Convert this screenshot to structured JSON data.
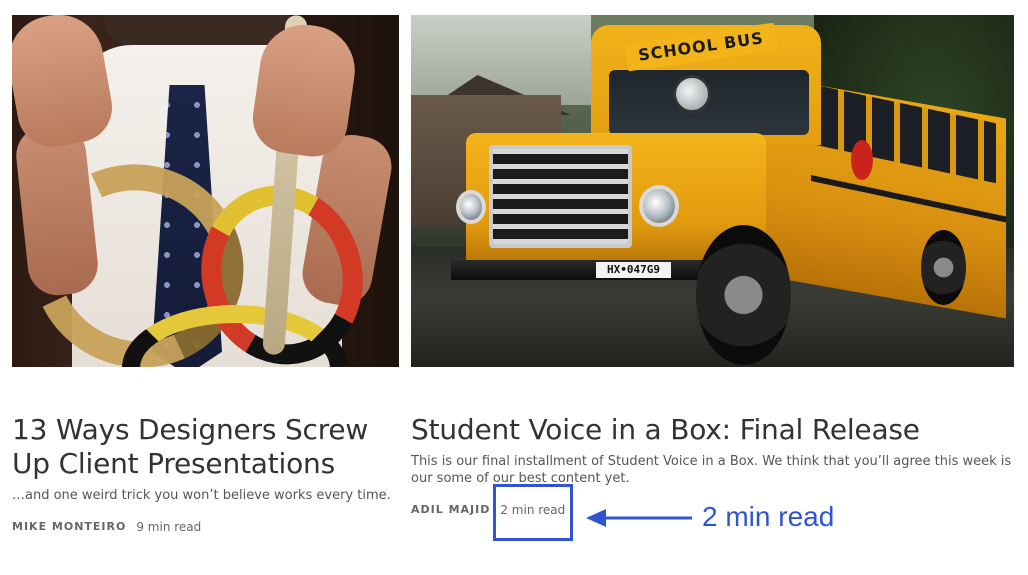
{
  "cards": [
    {
      "image": "designer-with-snakes-photo",
      "title": "13 Ways Designers Screw Up Client Presentations",
      "subtitle": "…and one weird trick you won’t believe works every time.",
      "author": "MIKE MONTEIRO",
      "read_time": "9 min read"
    },
    {
      "image": "school-bus-photo",
      "title": "Student Voice in a Box: Final Release",
      "subtitle": "This is our final installment of Student Voice in a Box. We think that you’ll agree this week is our some of our best content yet.",
      "author": "ADIL MAJID",
      "read_time": "2 min read"
    }
  ],
  "bus_image": {
    "sign_text": "SCHOOL BUS",
    "plate_text": "HX•047G9"
  },
  "annotation": {
    "callout": "2 min read",
    "color": "#2f55d4",
    "arrow_icon": "left-arrow-icon"
  }
}
